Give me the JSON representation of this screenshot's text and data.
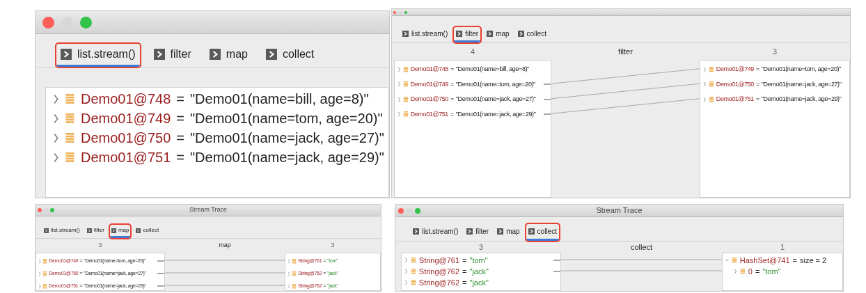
{
  "panels": [
    {
      "tabs": [
        {
          "label": "list.stream()",
          "selected": true,
          "annotated": true
        },
        {
          "label": "filter",
          "selected": false,
          "annotated": false
        },
        {
          "label": "map",
          "selected": false,
          "annotated": false
        },
        {
          "label": "collect",
          "selected": false,
          "annotated": false
        }
      ],
      "left": [
        {
          "name": "Demo01@748",
          "sep": "=",
          "value": "\"Demo01(name=bill, age=8)\"",
          "kind": "object",
          "expanded": false
        },
        {
          "name": "Demo01@749",
          "sep": "=",
          "value": "\"Demo01(name=tom, age=20)\"",
          "kind": "object",
          "expanded": false
        },
        {
          "name": "Demo01@750",
          "sep": "=",
          "value": "\"Demo01(name=jack, age=27)\"",
          "kind": "object",
          "expanded": false
        },
        {
          "name": "Demo01@751",
          "sep": "=",
          "value": "\"Demo01(name=jack, age=29)\"",
          "kind": "object",
          "expanded": false
        }
      ]
    },
    {
      "tabs": [
        {
          "label": "list.stream()",
          "selected": false,
          "annotated": false
        },
        {
          "label": "filter",
          "selected": true,
          "annotated": true
        },
        {
          "label": "map",
          "selected": false,
          "annotated": false
        },
        {
          "label": "collect",
          "selected": false,
          "annotated": false
        }
      ],
      "left_count": "4",
      "stage": "filter",
      "right_count": "3",
      "left": [
        {
          "name": "Demo01@748",
          "sep": "=",
          "value": "\"Demo01(name=bill, age=8)\"",
          "kind": "object",
          "expanded": false,
          "passed": false
        },
        {
          "name": "Demo01@749",
          "sep": "=",
          "value": "\"Demo01(name=tom, age=20)\"",
          "kind": "object",
          "expanded": false,
          "passed": true
        },
        {
          "name": "Demo01@750",
          "sep": "=",
          "value": "\"Demo01(name=jack, age=27)\"",
          "kind": "object",
          "expanded": false,
          "passed": true
        },
        {
          "name": "Demo01@751",
          "sep": "=",
          "value": "\"Demo01(name=jack, age=29)\"",
          "kind": "object",
          "expanded": false,
          "passed": true
        }
      ],
      "right": [
        {
          "name": "Demo01@749",
          "sep": "=",
          "value": "\"Demo01(name=tom, age=20)\"",
          "kind": "object",
          "expanded": false
        },
        {
          "name": "Demo01@750",
          "sep": "=",
          "value": "\"Demo01(name=jack, age=27)\"",
          "kind": "object",
          "expanded": false
        },
        {
          "name": "Demo01@751",
          "sep": "=",
          "value": "\"Demo01(name=jack, age=29)\"",
          "kind": "object",
          "expanded": false
        }
      ]
    },
    {
      "title": "Stream Trace",
      "tabs": [
        {
          "label": "list.stream()",
          "selected": false,
          "annotated": false
        },
        {
          "label": "filter",
          "selected": false,
          "annotated": false
        },
        {
          "label": "map",
          "selected": true,
          "annotated": true
        },
        {
          "label": "collect",
          "selected": false,
          "annotated": false
        }
      ],
      "left_count": "3",
      "stage": "map",
      "right_count": "3",
      "left": [
        {
          "name": "Demo01@749",
          "sep": "=",
          "value": "\"Demo01(name=tom, age=20)\"",
          "kind": "object",
          "expanded": false,
          "passed": true
        },
        {
          "name": "Demo01@750",
          "sep": "=",
          "value": "\"Demo01(name=jack, age=27)\"",
          "kind": "object",
          "expanded": false,
          "passed": true
        },
        {
          "name": "Demo01@751",
          "sep": "=",
          "value": "\"Demo01(name=jack, age=29)\"",
          "kind": "object",
          "expanded": false,
          "passed": true
        }
      ],
      "right": [
        {
          "name": "String@761",
          "sep": "=",
          "value": "\"tom\"",
          "kind": "string",
          "expanded": false
        },
        {
          "name": "String@762",
          "sep": "=",
          "value": "\"jack\"",
          "kind": "string",
          "expanded": false
        },
        {
          "name": "String@762",
          "sep": "=",
          "value": "\"jack\"",
          "kind": "string",
          "expanded": false
        }
      ]
    },
    {
      "title": "Stream Trace",
      "tabs": [
        {
          "label": "list.stream()",
          "selected": false,
          "annotated": false
        },
        {
          "label": "filter",
          "selected": false,
          "annotated": false
        },
        {
          "label": "map",
          "selected": false,
          "annotated": false
        },
        {
          "label": "collect",
          "selected": true,
          "annotated": true
        }
      ],
      "left_count": "3",
      "stage": "collect",
      "right_count": "1",
      "left": [
        {
          "name": "String@761",
          "sep": "=",
          "value": "\"tom\"",
          "kind": "string",
          "expanded": false,
          "passed": true
        },
        {
          "name": "String@762",
          "sep": "=",
          "value": "\"jack\"",
          "kind": "string",
          "expanded": false,
          "passed": true
        },
        {
          "name": "String@762",
          "sep": "=",
          "value": "\"jack\"",
          "kind": "string",
          "expanded": false,
          "passed": false
        }
      ],
      "right": [
        {
          "name": "HashSet@741",
          "sep": "=",
          "value": "size = 2",
          "kind": "object",
          "expanded": true,
          "children": [
            {
              "name": "0",
              "sep": "=",
              "value": "\"tom\"",
              "kind": "string",
              "expanded": false
            }
          ]
        }
      ]
    }
  ]
}
